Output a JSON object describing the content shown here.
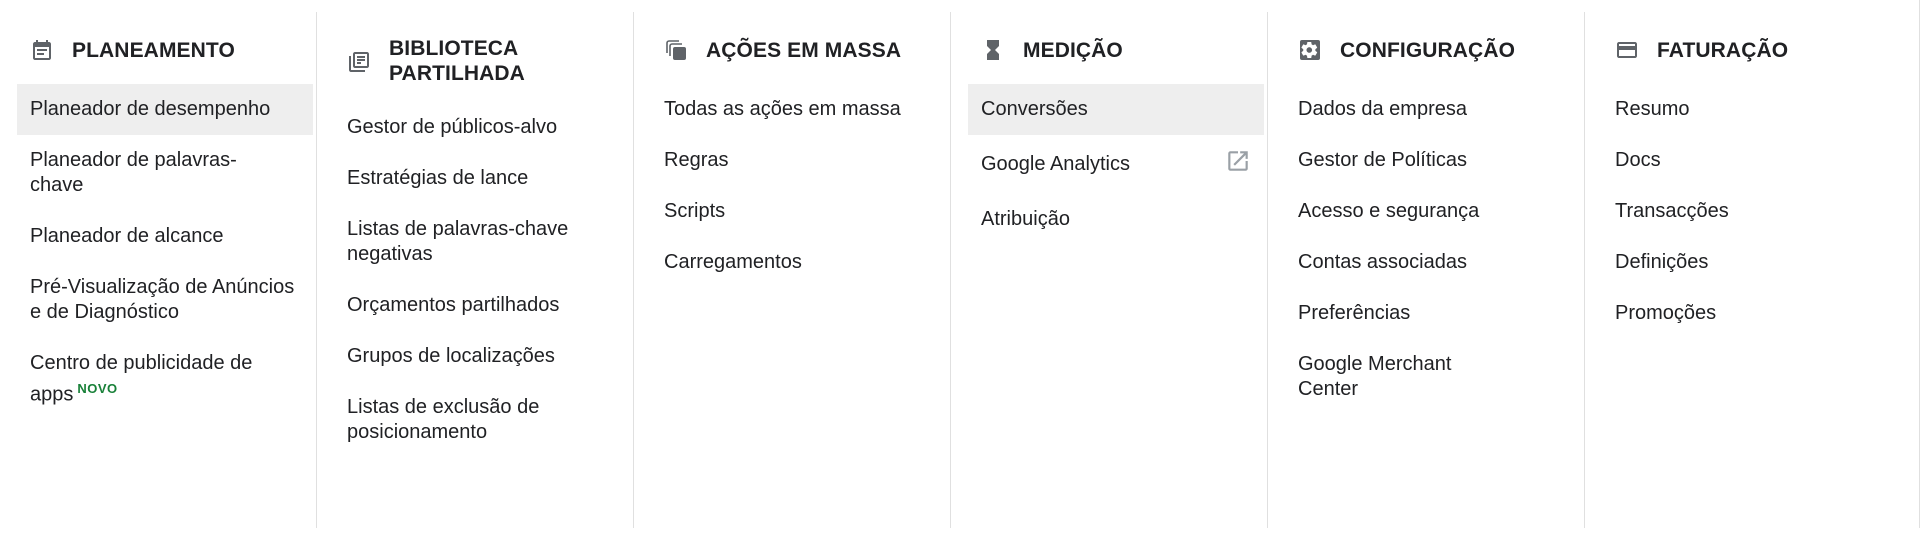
{
  "columns": [
    {
      "title": "PLANEAMENTO",
      "icon": "calendar-icon",
      "items": [
        {
          "label": "Planeador de desempenho",
          "selected": true
        },
        {
          "label": "Planeador de palavras-chave",
          "selected": false
        },
        {
          "label": "Planeador de alcance",
          "selected": false
        },
        {
          "label": "Pré-Visualização de Anúncios e de Diagnóstico",
          "selected": false
        },
        {
          "label": "Centro de publicidade de apps",
          "badge": "NOVO",
          "selected": false
        }
      ]
    },
    {
      "title": "BIBLIOTECA PARTILHADA",
      "icon": "library-icon",
      "items": [
        {
          "label": "Gestor de públicos-alvo"
        },
        {
          "label": "Estratégias de lance"
        },
        {
          "label": "Listas de palavras-chave negativas"
        },
        {
          "label": "Orçamentos partilhados"
        },
        {
          "label": "Grupos de localizações"
        },
        {
          "label": "Listas de exclusão de posicionamento"
        }
      ]
    },
    {
      "title": "AÇÕES EM MASSA",
      "icon": "copy-icon",
      "items": [
        {
          "label": "Todas as ações em massa"
        },
        {
          "label": "Regras"
        },
        {
          "label": "Scripts"
        },
        {
          "label": "Carregamentos"
        }
      ]
    },
    {
      "title": "MEDIÇÃO",
      "icon": "hourglass-icon",
      "items": [
        {
          "label": "Conversões",
          "selected": true
        },
        {
          "label": "Google Analytics",
          "external": true
        },
        {
          "label": "Atribuição"
        }
      ]
    },
    {
      "title": "CONFIGURAÇÃO",
      "icon": "settings-icon",
      "items": [
        {
          "label": "Dados da empresa"
        },
        {
          "label": "Gestor de Políticas"
        },
        {
          "label": "Acesso e segurança"
        },
        {
          "label": "Contas associadas"
        },
        {
          "label": "Preferências"
        },
        {
          "label": "Google Merchant Center"
        }
      ]
    },
    {
      "title": "FATURAÇÃO",
      "icon": "credit-card-icon",
      "items": [
        {
          "label": "Resumo"
        },
        {
          "label": "Docs"
        },
        {
          "label": "Transacções"
        },
        {
          "label": "Definições"
        },
        {
          "label": "Promoções"
        }
      ]
    }
  ],
  "colors": {
    "selected_bg": "#eeeeee",
    "badge": "#188038",
    "icon": "#5f6368",
    "divider": "#e0e0e0"
  }
}
